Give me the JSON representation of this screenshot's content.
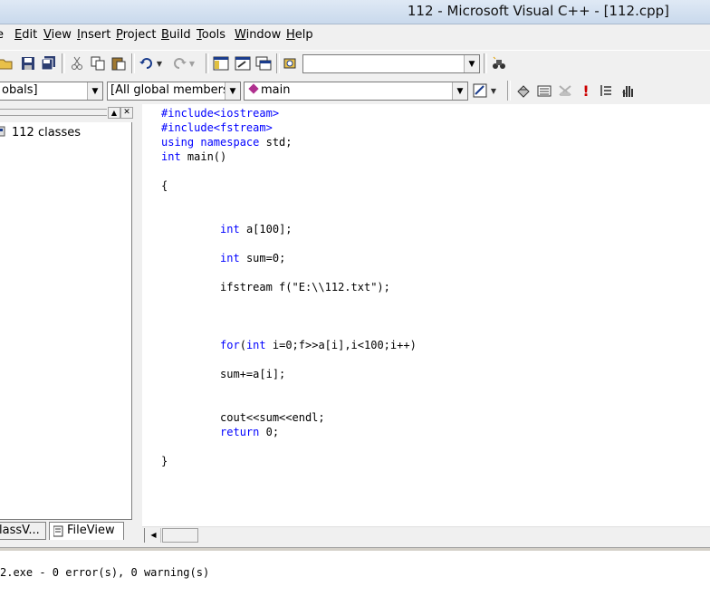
{
  "window": {
    "title": "112 - Microsoft Visual C++ - [112.cpp]"
  },
  "menu": {
    "items": [
      {
        "pre": "",
        "u": "",
        "post": "e"
      },
      {
        "pre": "",
        "u": "E",
        "post": "dit"
      },
      {
        "pre": "",
        "u": "V",
        "post": "iew"
      },
      {
        "pre": "",
        "u": "I",
        "post": "nsert"
      },
      {
        "pre": "",
        "u": "P",
        "post": "roject"
      },
      {
        "pre": "",
        "u": "B",
        "post": "uild"
      },
      {
        "pre": "",
        "u": "T",
        "post": "ools"
      },
      {
        "pre": "",
        "u": "W",
        "post": "indow"
      },
      {
        "pre": "",
        "u": "H",
        "post": "elp"
      }
    ]
  },
  "toolbar2": {
    "scope_combo": "obals]",
    "members_combo": "[All global members",
    "function_combo": "main"
  },
  "workspace": {
    "root_label": "112 classes",
    "tabs": [
      "lassV...",
      "FileView"
    ]
  },
  "editor": {
    "lines": [
      [
        {
          "t": "#include<iostream>",
          "k": true
        }
      ],
      [
        {
          "t": "#include<fstream>",
          "k": true
        }
      ],
      [
        {
          "t": "using namespace",
          "k": true
        },
        {
          "t": " std;",
          "k": false
        }
      ],
      [
        {
          "t": "int",
          "k": true
        },
        {
          "t": " main()",
          "k": false
        }
      ],
      [
        {
          "t": "",
          "k": false
        }
      ],
      [
        {
          "t": "{",
          "k": false
        }
      ],
      [
        {
          "t": "",
          "k": false
        }
      ],
      [
        {
          "t": "",
          "k": false
        }
      ],
      [
        {
          "t": "         ",
          "k": false
        },
        {
          "t": "int",
          "k": true
        },
        {
          "t": " a[100];",
          "k": false
        }
      ],
      [
        {
          "t": "",
          "k": false
        }
      ],
      [
        {
          "t": "         ",
          "k": false
        },
        {
          "t": "int",
          "k": true
        },
        {
          "t": " sum=0;",
          "k": false
        }
      ],
      [
        {
          "t": "",
          "k": false
        }
      ],
      [
        {
          "t": "         ifstream f(\"E:\\\\112.txt\");",
          "k": false
        }
      ],
      [
        {
          "t": "",
          "k": false
        }
      ],
      [
        {
          "t": "",
          "k": false
        }
      ],
      [
        {
          "t": "",
          "k": false
        }
      ],
      [
        {
          "t": "         ",
          "k": false
        },
        {
          "t": "for",
          "k": true
        },
        {
          "t": "(",
          "k": false
        },
        {
          "t": "int",
          "k": true
        },
        {
          "t": " i=0;f>>a[i],i<100;i++)",
          "k": false
        }
      ],
      [
        {
          "t": "",
          "k": false
        }
      ],
      [
        {
          "t": "         sum+=a[i];",
          "k": false
        }
      ],
      [
        {
          "t": "",
          "k": false
        }
      ],
      [
        {
          "t": "",
          "k": false
        }
      ],
      [
        {
          "t": "         cout<<sum<<endl;",
          "k": false
        }
      ],
      [
        {
          "t": "         ",
          "k": false
        },
        {
          "t": "return",
          "k": true
        },
        {
          "t": " 0;",
          "k": false
        }
      ],
      [
        {
          "t": "",
          "k": false
        }
      ],
      [
        {
          "t": "}",
          "k": false
        }
      ]
    ]
  },
  "output": {
    "text": "2.exe - 0 error(s), 0 warning(s)"
  },
  "colors": {
    "keyword": "#0000ff",
    "function_icon": "#b0308f",
    "stop_icon": "#cc0000"
  }
}
